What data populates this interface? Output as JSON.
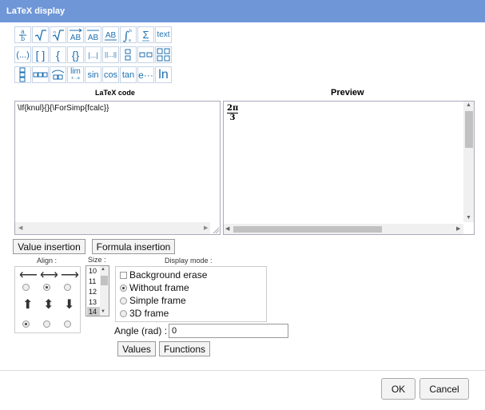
{
  "window": {
    "title": "LaTeX display"
  },
  "toolbar": {
    "text_btn": "text",
    "paren": "(...)",
    "bracket": "[ ]",
    "brace": "{",
    "braces": "{}",
    "abs": "|...|",
    "norm": "||...||",
    "lim": "lim",
    "lim_sub": "x→a",
    "sin": "sin",
    "cos": "cos",
    "tan": "tan",
    "exp": "e···",
    "ln": "ln"
  },
  "code": {
    "label": "LaTeX code",
    "value": "\\If{knul}{}{\\ForSimp{fcalc}}"
  },
  "preview": {
    "label": "Preview",
    "num": "2π",
    "den": "3"
  },
  "buttons": {
    "value_insertion": "Value insertion",
    "formula_insertion": "Formula insertion",
    "values": "Values",
    "functions": "Functions",
    "ok": "OK",
    "cancel": "Cancel"
  },
  "align": {
    "label": "Align :"
  },
  "size": {
    "label": "Size :",
    "options": [
      "10",
      "11",
      "12",
      "13",
      "14"
    ],
    "selected": "14"
  },
  "display_mode": {
    "label": "Display mode :",
    "background_erase": "Background erase",
    "without_frame": "Without frame",
    "simple_frame": "Simple frame",
    "frame_3d": "3D frame"
  },
  "angle": {
    "label": "Angle (rad) :",
    "value": "0"
  }
}
